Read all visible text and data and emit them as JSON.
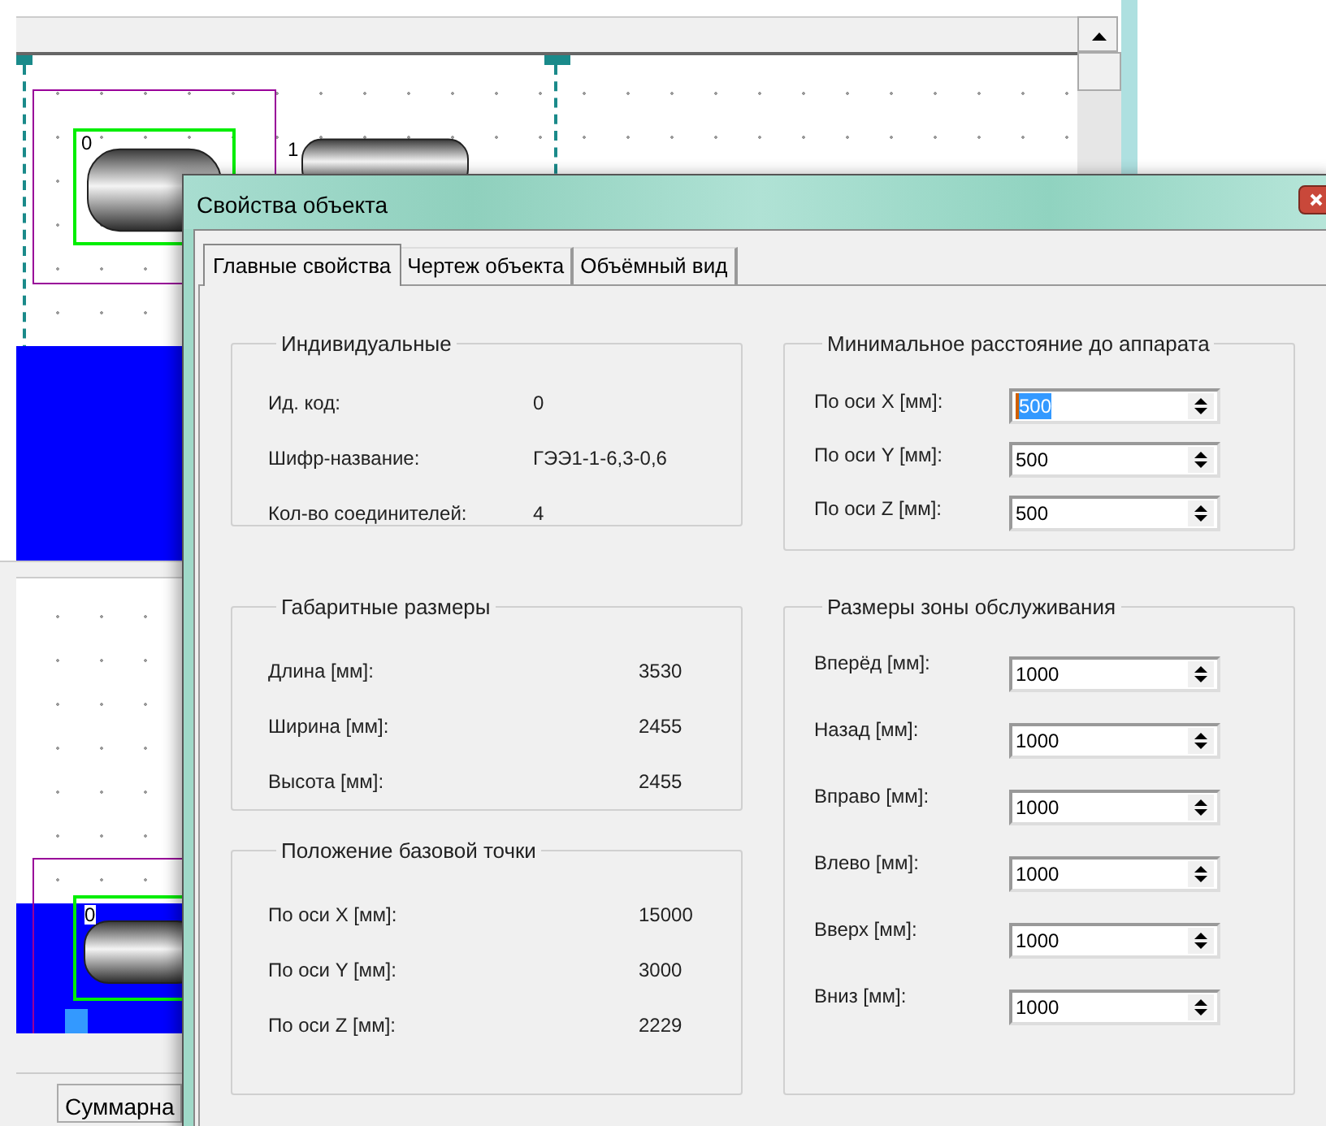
{
  "canvas_top": {
    "tank_labels": [
      "0",
      "1"
    ]
  },
  "canvas_bottom": {
    "tank_labels": [
      "0"
    ]
  },
  "status_bar": {
    "text": "Суммарна"
  },
  "dialog": {
    "title": "Свойства объекта",
    "tabs": [
      {
        "label": "Главные свойства",
        "selected": true
      },
      {
        "label": "Чертеж объекта",
        "selected": false
      },
      {
        "label": "Объёмный вид",
        "selected": false
      }
    ],
    "left_groups": [
      {
        "title": "Индивидуальные",
        "rows": [
          {
            "label": "Ид. код:",
            "value": "0"
          },
          {
            "label": "Шифр-название:",
            "value": "ГЭЭ1-1-6,3-0,6"
          },
          {
            "label": "Кол-во соединителей:",
            "value": "4"
          }
        ]
      },
      {
        "title": "Габаритные размеры",
        "rows": [
          {
            "label": "Длина [мм]:",
            "value": "3530"
          },
          {
            "label": "Ширина [мм]:",
            "value": "2455"
          },
          {
            "label": "Высота [мм]:",
            "value": "2455"
          }
        ]
      },
      {
        "title": "Положение базовой точки",
        "rows": [
          {
            "label": "По оси X [мм]:",
            "value": "15000"
          },
          {
            "label": "По оси Y [мм]:",
            "value": "3000"
          },
          {
            "label": "По оси Z [мм]:",
            "value": "2229"
          }
        ]
      }
    ],
    "right_groups": [
      {
        "title": "Минимальное расстояние  до аппарата",
        "fields": [
          {
            "label": "По оси X [мм]:",
            "value": "500",
            "focused": true
          },
          {
            "label": "По оси Y [мм]:",
            "value": "500",
            "focused": false
          },
          {
            "label": "По оси Z [мм]:",
            "value": "500",
            "focused": false
          }
        ]
      },
      {
        "title": "Размеры зоны обслуживания",
        "fields": [
          {
            "label": "Вперёд [мм]:",
            "value": "1000",
            "focused": false
          },
          {
            "label": "Назад [мм]:",
            "value": "1000",
            "focused": false
          },
          {
            "label": "Вправо [мм]:",
            "value": "1000",
            "focused": false
          },
          {
            "label": "Влево [мм]:",
            "value": "1000",
            "focused": false
          },
          {
            "label": "Вверх [мм]:",
            "value": "1000",
            "focused": false
          },
          {
            "label": "Вниз [мм]:",
            "value": "1000",
            "focused": false
          }
        ]
      }
    ]
  }
}
